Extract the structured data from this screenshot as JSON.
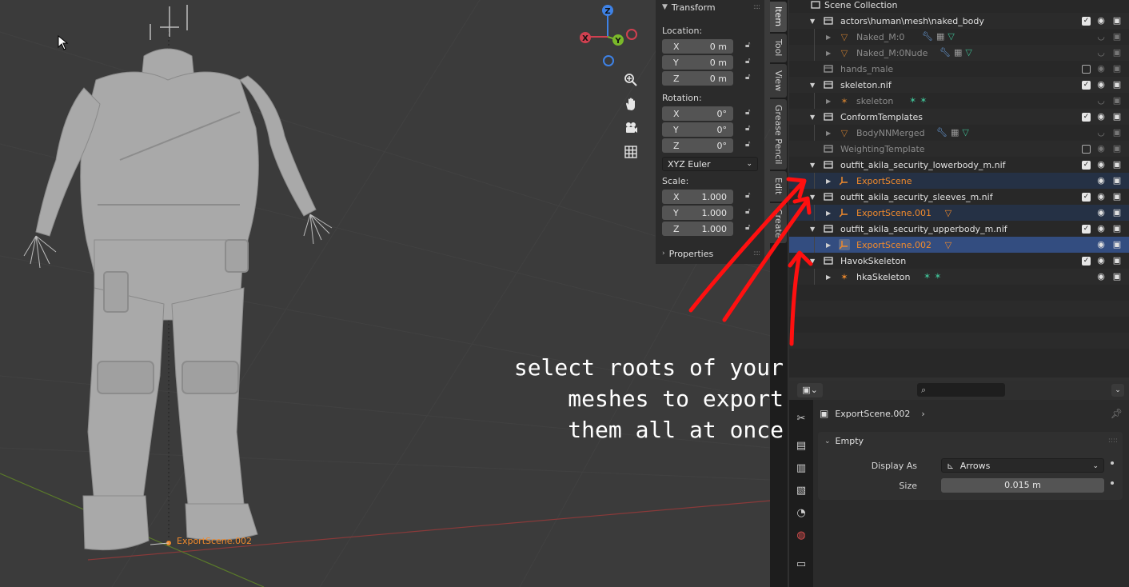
{
  "viewport": {
    "object_label": "ExportScene.002",
    "gizmo_axes": [
      "X",
      "Y",
      "Z"
    ],
    "nav_icons": [
      "zoom-icon",
      "hand-icon",
      "camera-icon",
      "grid-icon"
    ]
  },
  "npanel": {
    "section_title": "Transform",
    "location_label": "Location:",
    "location": [
      {
        "axis": "X",
        "value": "0 m"
      },
      {
        "axis": "Y",
        "value": "0 m"
      },
      {
        "axis": "Z",
        "value": "0 m"
      }
    ],
    "rotation_label": "Rotation:",
    "rotation": [
      {
        "axis": "X",
        "value": "0°"
      },
      {
        "axis": "Y",
        "value": "0°"
      },
      {
        "axis": "Z",
        "value": "0°"
      }
    ],
    "rotation_mode": "XYZ Euler",
    "scale_label": "Scale:",
    "scale": [
      {
        "axis": "X",
        "value": "1.000"
      },
      {
        "axis": "Y",
        "value": "1.000"
      },
      {
        "axis": "Z",
        "value": "1.000"
      }
    ],
    "properties_label": "Properties"
  },
  "vtabs": [
    "Item",
    "Tool",
    "View",
    "Grease Pencil",
    "Edit",
    "Create"
  ],
  "outliner": {
    "rows": [
      {
        "text": "Scene Collection",
        "style": "normal"
      },
      {
        "text": "actors\\human\\mesh\\naked_body",
        "style": "normal"
      },
      {
        "text": "Naked_M:0",
        "style": "dim"
      },
      {
        "text": "Naked_M:0Nude",
        "style": "dim"
      },
      {
        "text": "hands_male",
        "style": "dim"
      },
      {
        "text": "skeleton.nif",
        "style": "normal"
      },
      {
        "text": "skeleton",
        "style": "dim"
      },
      {
        "text": "ConformTemplates",
        "style": "normal"
      },
      {
        "text": "BodyNNMerged",
        "style": "dim"
      },
      {
        "text": "WeightingTemplate",
        "style": "dim"
      },
      {
        "text": "outfit_akila_security_lowerbody_m.nif",
        "style": "normal"
      },
      {
        "text": "ExportScene",
        "style": "orange"
      },
      {
        "text": "outfit_akila_security_sleeves_m.nif",
        "style": "normal"
      },
      {
        "text": "ExportScene.001",
        "style": "orange"
      },
      {
        "text": "outfit_akila_security_upperbody_m.nif",
        "style": "normal"
      },
      {
        "text": "ExportScene.002",
        "style": "orange"
      },
      {
        "text": "HavokSkeleton",
        "style": "normal"
      },
      {
        "text": "hkaSkeleton",
        "style": "normal"
      }
    ]
  },
  "properties": {
    "object_name": "ExportScene.002",
    "panel_title": "Empty",
    "display_as_label": "Display As",
    "display_as_value": "Arrows",
    "size_label": "Size",
    "size_value": "0.015 m"
  },
  "annotation": {
    "text": "select roots of your\nmeshes to export\nthem all at once"
  },
  "colors": {
    "selection": "#334d80",
    "active_object": "#f08a2c",
    "annotation_arrow": "#ff1010"
  }
}
